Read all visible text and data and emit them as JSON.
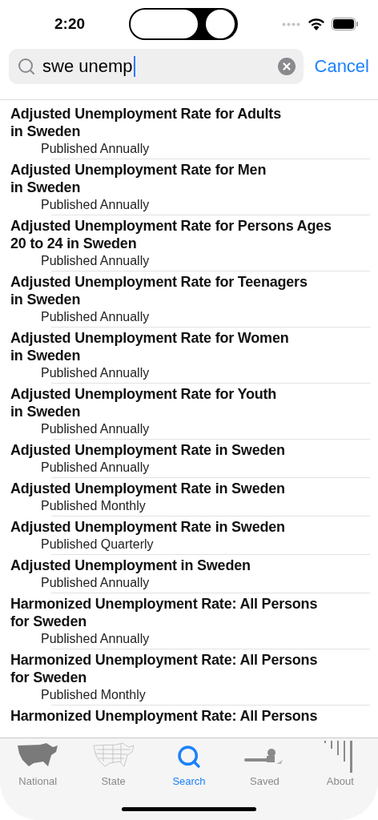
{
  "status_bar": {
    "time": "2:20"
  },
  "search": {
    "value": "swe unemp",
    "cancel": "Cancel"
  },
  "results": [
    {
      "title": "Adjusted Unemployment Rate for Adults\nin Sweden",
      "subtitle": "Published Annually"
    },
    {
      "title": "Adjusted Unemployment Rate for Men\nin Sweden",
      "subtitle": "Published Annually"
    },
    {
      "title": "Adjusted Unemployment Rate for Persons Ages\n20 to 24 in Sweden",
      "subtitle": "Published Annually"
    },
    {
      "title": "Adjusted Unemployment Rate for Teenagers\nin Sweden",
      "subtitle": "Published Annually"
    },
    {
      "title": "Adjusted Unemployment Rate for Women\nin Sweden",
      "subtitle": "Published Annually"
    },
    {
      "title": "Adjusted Unemployment Rate for Youth\nin Sweden",
      "subtitle": "Published Annually"
    },
    {
      "title": "Adjusted Unemployment Rate in Sweden",
      "subtitle": "Published Annually"
    },
    {
      "title": "Adjusted Unemployment Rate in Sweden",
      "subtitle": "Published Monthly"
    },
    {
      "title": "Adjusted Unemployment Rate in Sweden",
      "subtitle": "Published Quarterly"
    },
    {
      "title": "Adjusted Unemployment in Sweden",
      "subtitle": "Published Annually"
    },
    {
      "title": "Harmonized Unemployment Rate: All Persons\nfor Sweden",
      "subtitle": "Published Annually"
    },
    {
      "title": "Harmonized Unemployment Rate: All Persons\nfor Sweden",
      "subtitle": "Published Monthly"
    },
    {
      "title": "Harmonized Unemployment Rate: All Persons"
    }
  ],
  "tabs": [
    {
      "kind": "national",
      "label": "National",
      "selected": false
    },
    {
      "kind": "state",
      "label": "State",
      "selected": false
    },
    {
      "kind": "search",
      "label": "Search",
      "selected": true
    },
    {
      "kind": "saved",
      "label": "Saved",
      "selected": false
    },
    {
      "kind": "about",
      "label": "About",
      "selected": false
    }
  ]
}
